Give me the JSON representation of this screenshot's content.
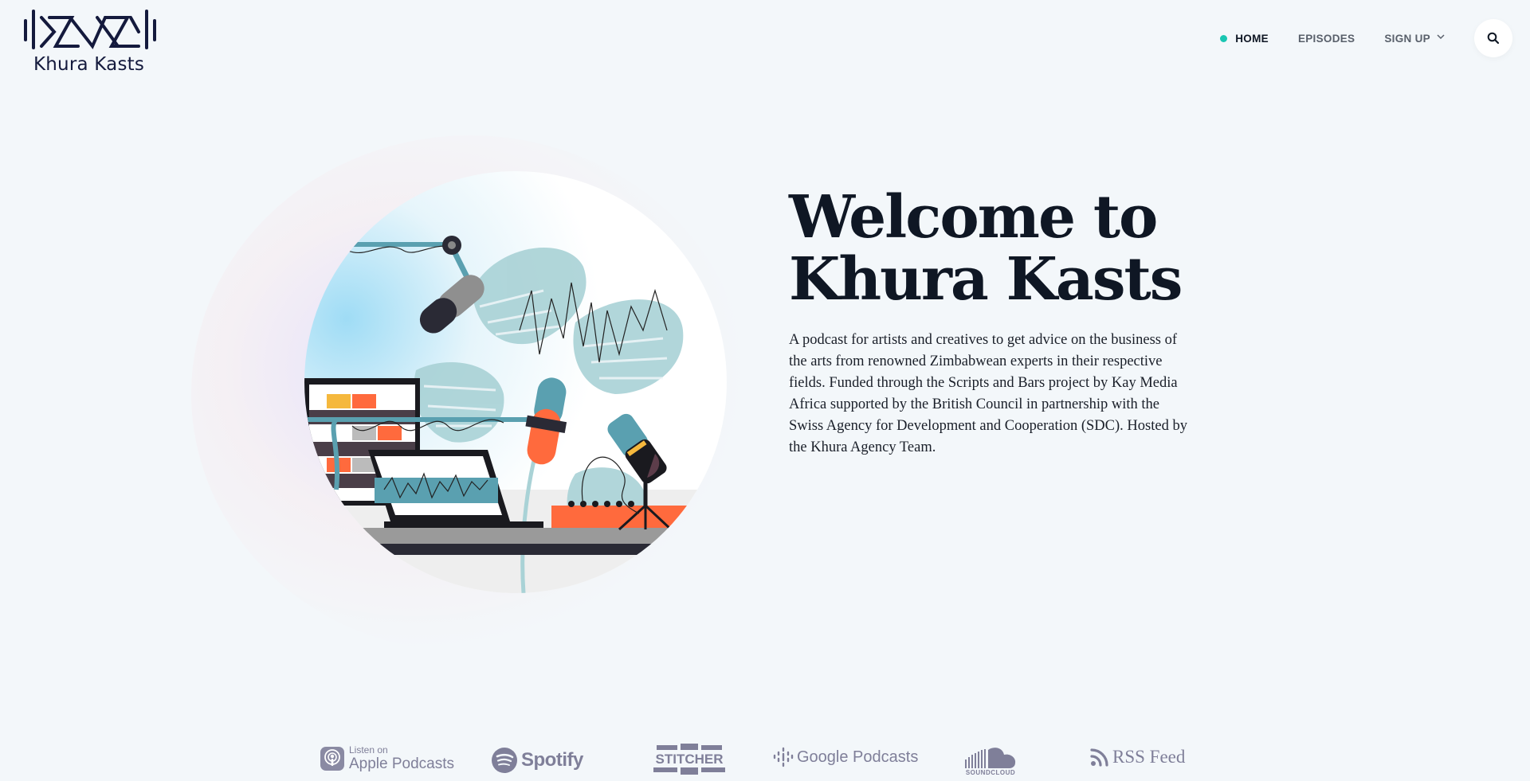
{
  "brand": {
    "name": "Khura Kasts"
  },
  "nav": {
    "items": [
      {
        "label": "HOME",
        "active": true
      },
      {
        "label": "EPISODES",
        "active": false
      },
      {
        "label": "SIGN UP",
        "active": false,
        "has_dropdown": true
      }
    ],
    "search_icon": "search-icon",
    "active_dot_color": "#19c6b2"
  },
  "hero": {
    "title_line1": "Welcome to",
    "title_line2": "Khura Kasts",
    "description": "A podcast for artists and creatives to get advice on the business of the arts from renowned Zimbabwean experts in their respective fields. Funded through the Scripts and Bars project by Kay Media Africa supported by the British Council in partnership with the Swiss Agency for Development and Cooperation (SDC). Hosted by the Khura Agency Team."
  },
  "platforms": {
    "apple": {
      "small": "Listen on",
      "name": "Apple Podcasts"
    },
    "spotify": {
      "name": "Spotify"
    },
    "stitcher": {
      "name": "STITCHER"
    },
    "google": {
      "name": "Google Podcasts"
    },
    "soundcloud": {
      "name": "SOUNDCLOUD"
    },
    "rss": {
      "name": "RSS Feed"
    }
  }
}
